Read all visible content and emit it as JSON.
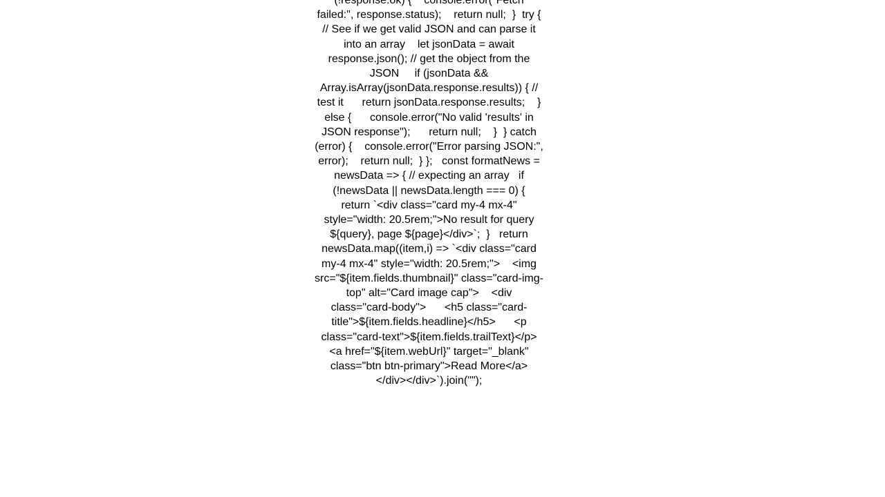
{
  "page": {
    "background_color": "#ffffff",
    "text_color": "#000000",
    "alignment": "center",
    "clipped_top": true,
    "clipped_bottom": true
  },
  "code_block": {
    "language": "javascript",
    "clipped_first_line": "(!response.ok) {",
    "clipped_last_line": "</div>`).join(\"\");",
    "text": "(!response.ok) {    console.error(\"Fetch failed:\", response.status);    return null;  }  try { // See if we get valid JSON and can parse it into an array    let jsonData = await response.json(); // get the object from the JSON     if (jsonData && Array.isArray(jsonData.response.results)) { // test it      return jsonData.response.results;    } else {      console.error(\"No valid 'results' in JSON response\");      return null;    }  } catch (error) {    console.error(\"Error parsing JSON:\", error);    return null;  } };   const formatNews = newsData => { // expecting an array   if (!newsData || newsData.length === 0) {    return `<div class=\"card my-4 mx-4\" style=\"width: 20.5rem;\">No result for query ${query}, page ${page}</div>`;  }   return newsData.map((item,i) => `<div class=\"card my-4 mx-4\" style=\"width: 20.5rem;\">    <img src=\"${item.fields.thumbnail}\" class=\"card-img-top\" alt=\"Card image cap\">    <div class=\"card-body\">      <h5 class=\"card-title\">${item.fields.headline}</h5>      <p class=\"card-text\">${item.fields.trailText}</p>      <a href=\"${item.webUrl}\" target=\"_blank\" class=\"btn btn-primary\">Read More</a>    </div></div>`).join(\"\");",
    "lines": [
      "(!response.ok) {",
      "console.error(\"Fetch failed:\",",
      "response.status);    return null;  }",
      "try { // See if we get valid JSON and",
      "can parse it into an array    let",
      "jsonData = await response.json(); // get",
      "the object from the JSON     if",
      "(jsonData && Array.isArray(jsonData.resp",
      "onse.results)) { // test it",
      "return jsonData.response.results;    }",
      "else {      console.error(\"No valid",
      "'results' in JSON response\");",
      "return null;    }  } catch (error) {",
      "console.error(\"Error parsing JSON:\",",
      "error);    return null;  } };   const",
      "formatNews = newsData => { // expecting",
      "an array   if (!newsData ||",
      "newsData.length === 0) {    return",
      "`<div class=\"card my-4 mx-4\"",
      "style=\"width: 20.5rem;\">No result for",
      "query ${query}, page ${page}</div>`;  }",
      "return newsData.map((item,i) => `<div",
      "class=\"card my-4 mx-4\" style=\"width:",
      "20.5rem;\">    <img",
      "src=\"${item.fields.thumbnail}\"",
      "class=\"card-img-top\" alt=\"Card image",
      "cap\">    <div class=\"card-body\">",
      "<h5 class=\"card-",
      "title\">${item.fields.headline}</h5>",
      "<p class=\"card-",
      "text\">${item.fields.trailText}</p>",
      "<a href=\"${item.webUrl}\" target=\"_blank\"",
      "class=\"btn btn-primary\">Read More</a>",
      "</div></div>`).join(\"\");"
    ]
  }
}
